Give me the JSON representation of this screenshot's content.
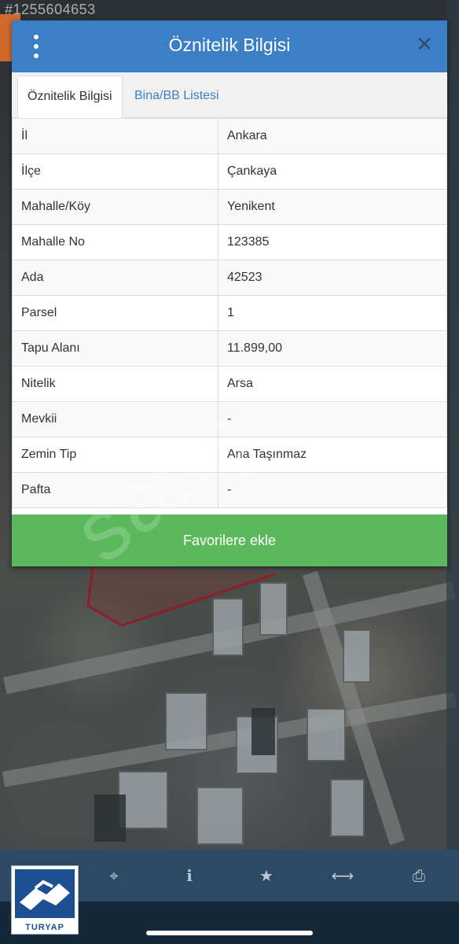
{
  "listing_id": "#1255604653",
  "panel": {
    "title": "Öznitelik Bilgisi",
    "tabs": [
      "Öznitelik Bilgisi",
      "Bina/BB Listesi"
    ],
    "rows": [
      {
        "key": "İl",
        "value": "Ankara"
      },
      {
        "key": "İlçe",
        "value": "Çankaya"
      },
      {
        "key": "Mahalle/Köy",
        "value": "Yenikent"
      },
      {
        "key": "Mahalle No",
        "value": "123385"
      },
      {
        "key": "Ada",
        "value": "42523"
      },
      {
        "key": "Parsel",
        "value": "1"
      },
      {
        "key": "Tapu Alanı",
        "value": "11.899,00"
      },
      {
        "key": "Nitelik",
        "value": "Arsa"
      },
      {
        "key": "Mevkii",
        "value": "-"
      },
      {
        "key": "Zemin Tip",
        "value": "Ana Taşınmaz"
      },
      {
        "key": "Pafta",
        "value": "-"
      }
    ],
    "favorite_button": "Favorilere ekle"
  },
  "watermark": "satış",
  "toolbar": {
    "icons": [
      "crosshair-icon",
      "info-icon",
      "star-icon",
      "measure-icon",
      "print-icon"
    ]
  },
  "logo_text": "TURYAP",
  "colors": {
    "header": "#3b80c6",
    "favorite": "#5cb85c",
    "toolbar": "#2c4a63"
  }
}
